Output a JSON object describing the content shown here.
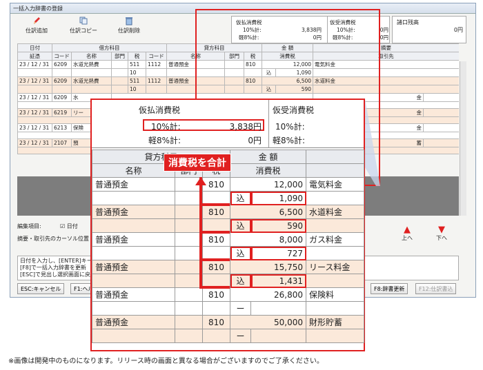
{
  "window": {
    "title": "一括入力辞書の登録"
  },
  "toolbar": {
    "add": "仕訳追加",
    "copy": "仕訳コピー",
    "delete": "仕訳削除"
  },
  "tax_info": {
    "paid_label": "仮払消費税",
    "received_label": "仮受消費税",
    "balance_label": "諸口残高",
    "rate10": "10%計:",
    "rate8": "軽8%計:",
    "paid10": "3,838円",
    "paid8": "0円",
    "recv10": "0円",
    "recv8": "0円",
    "balance": "0円"
  },
  "grid_headers": {
    "date": "日付",
    "slip": "証憑",
    "debit": "借方科目",
    "credit": "貸方科目",
    "amount": "金 額",
    "summary": "摘要",
    "code": "コード",
    "name": "名称",
    "dept": "部門",
    "tax": "税",
    "ctax": "消費税",
    "partner": "取引先"
  },
  "rows": [
    {
      "date": "23 / 12 / 31",
      "dcode": "6209",
      "dname": "水道光熱費",
      "dtax": "511",
      "dtax2": "10",
      "ccode": "1112",
      "cname": "普通預金",
      "ctax": "810",
      "amount": "12,000",
      "ctaxamt": "1,090",
      "summary": "電気料金"
    },
    {
      "date": "23 / 12 / 31",
      "dcode": "6209",
      "dname": "水道光熱費",
      "dtax": "511",
      "dtax2": "10",
      "ccode": "1112",
      "cname": "普通預金",
      "ctax": "810",
      "amount": "6,500",
      "ctaxamt": "590",
      "summary": "水道料金"
    },
    {
      "date": "23 / 12 / 31",
      "dcode": "6209",
      "dname": "水"
    },
    {
      "date": "23 / 12 / 31",
      "dcode": "6219",
      "dname": "リー"
    },
    {
      "date": "23 / 12 / 31",
      "dcode": "6213",
      "dname": "保険"
    },
    {
      "date": "23 / 12 / 31",
      "dcode": "2107",
      "dname": "預"
    }
  ],
  "small_right": {
    "r3": "金",
    "r4": "金",
    "r5": "金",
    "r6": "蓄"
  },
  "bottom": {
    "edit_label": "編集項目:",
    "date_check": "日付",
    "cursor_note": "摘要・取引先のカーソル位置",
    "help1": "日付を入力し、[ENTER]キー",
    "help2": "[F8]で一括入力辞書を更新",
    "help3": "[ESC]で見出し選択画面に戻",
    "up": "上へ",
    "down": "下へ",
    "esc": "ESC:キャンセル",
    "f1": "F1:ヘル",
    "f8": "F8:辞書更新",
    "f12": "F12:仕訳書込"
  },
  "zoom": {
    "paid_label": "仮払消費税",
    "recv_label": "仮受消費税",
    "rate10": "10%計:",
    "rate8": "軽8%計:",
    "paid10": "3,838円",
    "paid8": "0円",
    "credit_hdr": "貸方科目",
    "amount_hdr": "金 額",
    "name": "名称",
    "dept": "部門",
    "tax": "税",
    "ctax": "消費税",
    "callout": "消費税を合計",
    "incl": "込",
    "dash": "ー",
    "rows": [
      {
        "name": "普通預金",
        "tax": "810",
        "amount": "12,000",
        "summary": "電気料金",
        "ctax": "1,090"
      },
      {
        "name": "普通預金",
        "tax": "810",
        "amount": "6,500",
        "summary": "水道料金",
        "ctax": "590"
      },
      {
        "name": "普通預金",
        "tax": "810",
        "amount": "8,000",
        "summary": "ガス料金",
        "ctax": "727"
      },
      {
        "name": "普通預金",
        "tax": "810",
        "amount": "15,750",
        "summary": "リース料金",
        "ctax": "1,431"
      },
      {
        "name": "普通預金",
        "tax": "810",
        "amount": "26,800",
        "summary": "保険料"
      },
      {
        "name": "普通預金",
        "tax": "810",
        "amount": "50,000",
        "summary": "財形貯蓄"
      }
    ]
  },
  "footnote": "※画像は開発中のものになります。リリース時の画面と異なる場合がございますのでご了承ください。"
}
